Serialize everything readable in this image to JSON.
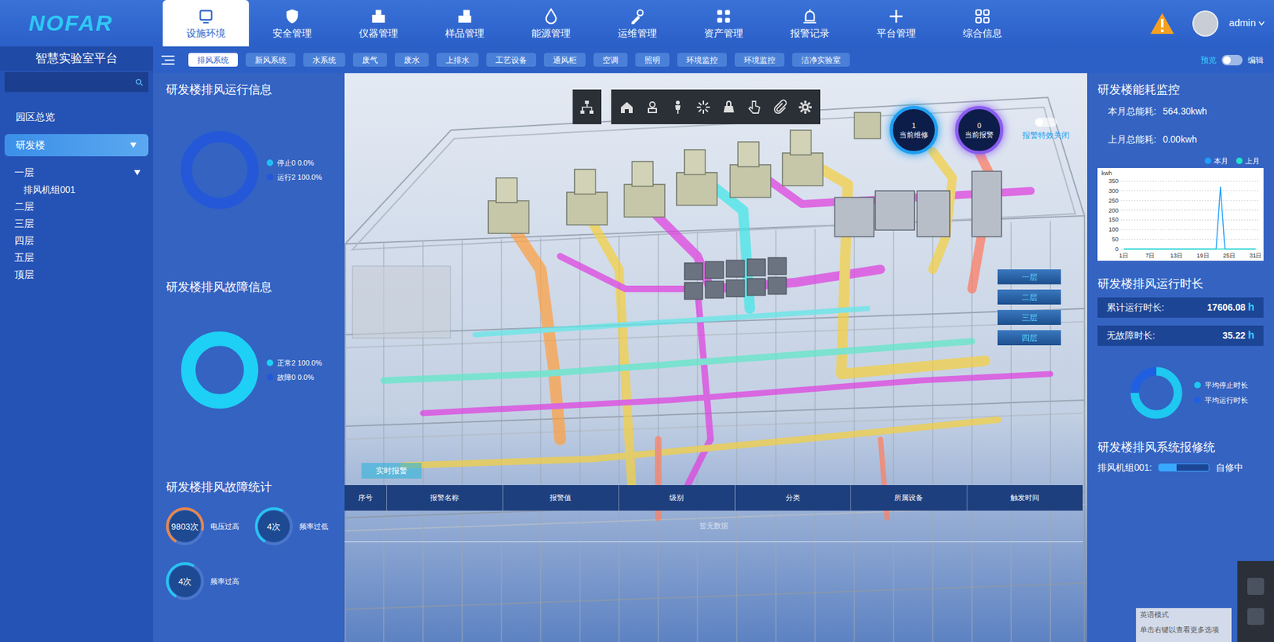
{
  "header": {
    "logo": "NOFAR",
    "nav": [
      {
        "label": "设施环境",
        "selected": true
      },
      {
        "label": "安全管理",
        "selected": false
      },
      {
        "label": "仪器管理",
        "selected": false
      },
      {
        "label": "样品管理",
        "selected": false
      },
      {
        "label": "能源管理",
        "selected": false
      },
      {
        "label": "运维管理",
        "selected": false
      },
      {
        "label": "资产管理",
        "selected": false
      },
      {
        "label": "报警记录",
        "selected": false
      },
      {
        "label": "平台管理",
        "selected": false
      },
      {
        "label": "综合信息",
        "selected": false
      }
    ],
    "user": "admin"
  },
  "sidebar": {
    "title": "智慧实验室平台",
    "items": [
      {
        "label": "园区总览",
        "kind": "link",
        "selected": false
      },
      {
        "label": "研发楼",
        "kind": "building",
        "selected": true,
        "expanded": true
      },
      {
        "label": "一层",
        "kind": "floor",
        "selected": false,
        "expanded": true
      },
      {
        "label": "排风机组001",
        "kind": "device",
        "selected": false
      },
      {
        "label": "二层",
        "kind": "floor",
        "selected": false
      },
      {
        "label": "三层",
        "kind": "floor",
        "selected": false
      },
      {
        "label": "四层",
        "kind": "floor",
        "selected": false
      },
      {
        "label": "五层",
        "kind": "floor",
        "selected": false
      },
      {
        "label": "顶层",
        "kind": "floor",
        "selected": false
      }
    ]
  },
  "subnav": {
    "chips": [
      {
        "label": "排风系统",
        "selected": true
      },
      {
        "label": "新风系统",
        "selected": false
      },
      {
        "label": "水系统",
        "selected": false
      },
      {
        "label": "废气",
        "selected": false
      },
      {
        "label": "废水",
        "selected": false
      },
      {
        "label": "上排水",
        "selected": false
      },
      {
        "label": "工艺设备",
        "selected": false
      },
      {
        "label": "通风柜",
        "selected": false
      },
      {
        "label": "空调",
        "selected": false
      },
      {
        "label": "照明",
        "selected": false
      },
      {
        "label": "环境监控",
        "selected": false
      },
      {
        "label": "环境监控",
        "selected": false
      },
      {
        "label": "洁净实验室",
        "selected": false
      }
    ],
    "mode": {
      "preview": "预览",
      "edit": "编辑",
      "on": false
    }
  },
  "left": {
    "run_info": {
      "title": "研发楼排风运行信息",
      "legend": [
        {
          "text": "停止0 0.0%",
          "value": 0,
          "color": "#1fc0f5"
        },
        {
          "text": "运行2 100.0%",
          "value": 2,
          "color": "#2458d8"
        }
      ]
    },
    "fault_info": {
      "title": "研发楼排风故障信息",
      "legend": [
        {
          "text": "正常2 100.0%",
          "value": 2,
          "color": "#1ed0f5"
        },
        {
          "text": "故障0 0.0%",
          "value": 0,
          "color": "#2458d8"
        }
      ]
    },
    "fault_stats": {
      "title": "研发楼排风故障统计",
      "items": [
        {
          "count": "9803次",
          "label": "电压过高",
          "color": "#e8874a",
          "level": 0.7
        },
        {
          "count": "4次",
          "label": "频率过低",
          "color": "#26c6f0",
          "level": 0.5
        },
        {
          "count": "4次",
          "label": "频率过高",
          "color": "#26c6f0",
          "level": 0.5
        }
      ]
    }
  },
  "scene": {
    "counters": [
      {
        "value": "1",
        "label": "当前维修",
        "color": "#1f9ef0"
      },
      {
        "value": "0",
        "label": "当前报警",
        "color": "#8a5cf0"
      }
    ],
    "alarm_effect": {
      "label": "报警特效关闭",
      "on": false
    },
    "floors": [
      "一层",
      "二层",
      "三层",
      "四层"
    ],
    "alarms": {
      "tab": "实时报警",
      "columns": [
        "序号",
        "报警名称",
        "报警值",
        "级别",
        "分类",
        "所属设备",
        "触发时间"
      ],
      "rows": [],
      "empty": "暂无数据"
    }
  },
  "right": {
    "energy": {
      "title": "研发楼能耗监控",
      "this_month": {
        "label": "本月总能耗:",
        "value": "564.30kwh"
      },
      "last_month": {
        "label": "上月总能耗:",
        "value": "0.00kwh"
      },
      "chart": {
        "unit": "kwh",
        "y_ticks": [
          "350",
          "300",
          "250",
          "200",
          "150",
          "100",
          "50",
          "0"
        ],
        "x_ticks": [
          "1日",
          "7日",
          "13日",
          "19日",
          "25日",
          "31日"
        ],
        "max": 350,
        "series": [
          {
            "name": "本月",
            "color": "#1e9fff",
            "values": [
              0,
              0,
              0,
              0,
              0,
              0,
              0,
              0,
              0,
              0,
              0,
              0,
              0,
              0,
              0,
              0,
              0,
              0,
              0,
              0,
              0,
              0,
              320,
              0,
              0,
              0,
              0,
              0,
              0,
              0,
              0
            ]
          },
          {
            "name": "上月",
            "color": "#22e0c8",
            "values": [
              0,
              0,
              0,
              0,
              0,
              0,
              0,
              0,
              0,
              0,
              0,
              0,
              0,
              0,
              0,
              0,
              0,
              0,
              0,
              0,
              0,
              0,
              0,
              0,
              0,
              0,
              0,
              0,
              0,
              0,
              0
            ]
          }
        ]
      }
    },
    "runtime": {
      "title": "研发楼排风运行时长",
      "rows": [
        {
          "label": "累计运行时长:",
          "value": "17606.08",
          "unit": "h"
        },
        {
          "label": "无故障时长:",
          "value": "35.22",
          "unit": "h"
        }
      ],
      "legend": [
        {
          "text": "平均停止时长",
          "value": 75,
          "color": "#1ec8f0"
        },
        {
          "text": "平均运行时长",
          "value": 25,
          "color": "#2060e0"
        }
      ]
    },
    "repair": {
      "title": "研发楼排风系统报修统",
      "items": [
        {
          "name": "排风机组001:",
          "level": 0.35,
          "status": "自修中"
        }
      ]
    }
  },
  "ime": {
    "lines": [
      "英语模式",
      "单击右键以查看更多选项"
    ]
  }
}
